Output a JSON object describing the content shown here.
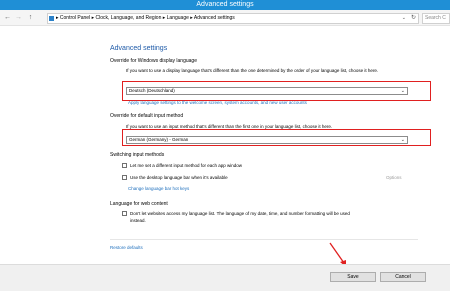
{
  "window": {
    "title": "Advanced settings"
  },
  "nav": {
    "back_icon": "←",
    "forward_icon": "→",
    "up_icon": "↑",
    "breadcrumb": [
      "Control Panel",
      "Clock, Language, and Region",
      "Language",
      "Advanced settings"
    ],
    "breadcrumb_text": "▸ Control Panel ▸ Clock, Language, and Region ▸ Language ▸ Advanced settings",
    "dropdown_icon": "⌄",
    "refresh_icon": "↻",
    "search_placeholder": "Search C"
  },
  "main": {
    "heading": "Advanced settings",
    "display_language": {
      "title": "Override for Windows display language",
      "description": "If you want to use a display language that's different than the one determined by the order of your language list, choose it here.",
      "selected": "Deutsch (Deutschland)",
      "link": "Apply language settings to the welcome screen, system accounts, and new user accounts"
    },
    "input_method": {
      "title": "Override for default input method",
      "description": "If you want to use an input method that's different than the first one in your language list, choose it here.",
      "selected": "German (Germany) - German"
    },
    "switching": {
      "title": "Switching input methods",
      "option1": "Let me set a different input method for each app window",
      "option2": "Use the desktop language bar when it's available",
      "options_link": "Options",
      "hotkeys_link": "Change language bar hot keys"
    },
    "web_content": {
      "title": "Language for web content",
      "option": "Don't let websites access my language list. The language of my date, time, and number formatting will be used",
      "option_cont": "instead."
    },
    "restore_link": "Restore defaults"
  },
  "footer": {
    "save": "Save",
    "cancel": "Cancel"
  },
  "colors": {
    "titlebar": "#1f8fd6",
    "link": "#1e6fbd",
    "highlight": "#e02020",
    "heading": "#1e5aa8"
  }
}
